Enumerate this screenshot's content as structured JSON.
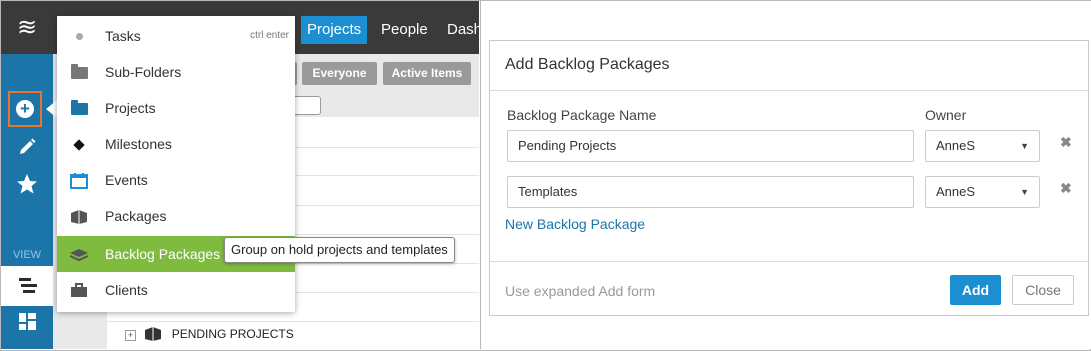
{
  "sidebar": {
    "logo": "≋",
    "view_label": "VIEW",
    "icons": [
      "add-icon",
      "pencil-icon",
      "star-icon",
      "list-view-icon",
      "board-view-icon"
    ],
    "accent_color": "#1b75a8",
    "highlight_color": "#e8752a"
  },
  "header": {
    "nav": [
      "Projects",
      "People",
      "Dash"
    ],
    "active_color": "#1b8fd1"
  },
  "filters": {
    "everyone": "Everyone",
    "active_items": "Active Items"
  },
  "tree": {
    "visible_row": "PENDING PROJECTS"
  },
  "add_menu": {
    "items": [
      {
        "label": "Tasks",
        "icon": "dot-icon",
        "shortcut": "ctrl enter"
      },
      {
        "label": "Sub-Folders",
        "icon": "folder-grey-icon"
      },
      {
        "label": "Projects",
        "icon": "folder-blue-icon"
      },
      {
        "label": "Milestones",
        "icon": "diamond-icon"
      },
      {
        "label": "Events",
        "icon": "calendar-icon"
      },
      {
        "label": "Packages",
        "icon": "package-icon"
      },
      {
        "label": "Backlog Packages",
        "icon": "layers-icon",
        "active": true
      },
      {
        "label": "Clients",
        "icon": "briefcase-icon"
      }
    ],
    "active_color": "#7ebb3f",
    "tooltip": "Group on hold projects and templates"
  },
  "dialog": {
    "title": "Add Backlog Packages",
    "name_label": "Backlog Package Name",
    "owner_label": "Owner",
    "rows": [
      {
        "name": "Pending Projects",
        "owner": "AnneS"
      },
      {
        "name": "Templates",
        "owner": "AnneS"
      }
    ],
    "new_link": "New Backlog Package",
    "expanded_link": "Use expanded Add form",
    "add_button": "Add",
    "close_button": "Close"
  }
}
